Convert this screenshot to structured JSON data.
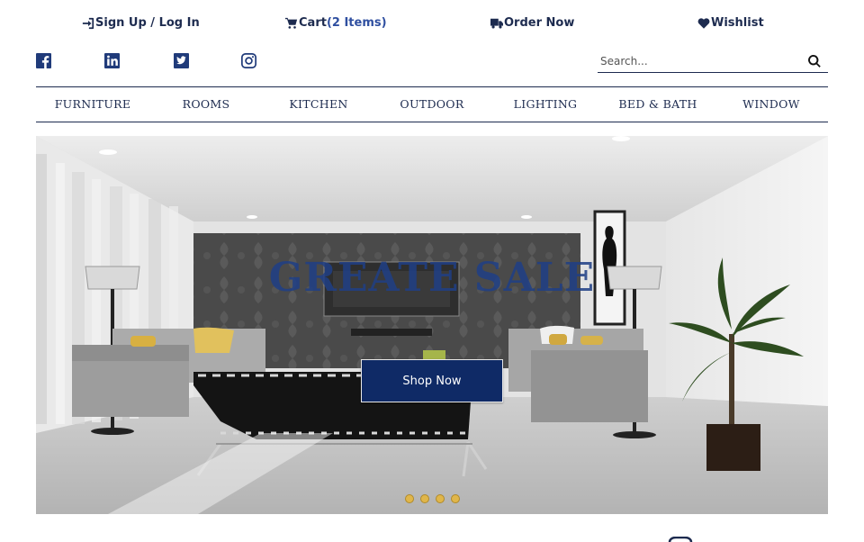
{
  "header": {
    "signup_label": "Sign Up / Log In",
    "cart_label": "Cart",
    "cart_count": "(2 Items)",
    "order_label": "Order Now",
    "wishlist_label": "Wishlist",
    "icons": [
      "sign-in-icon",
      "cart-icon",
      "truck-icon",
      "heart-icon"
    ]
  },
  "social": [
    "facebook-icon",
    "linkedin-icon",
    "twitter-icon",
    "instagram-icon"
  ],
  "search": {
    "placeholder": "Search...",
    "value": ""
  },
  "nav": {
    "items": [
      {
        "label": "FURNITURE"
      },
      {
        "label": "ROOMS"
      },
      {
        "label": "KITCHEN"
      },
      {
        "label": "OUTDOOR"
      },
      {
        "label": "LIGHTING"
      },
      {
        "label": "BED & BATH"
      },
      {
        "label": "WINDOW"
      }
    ]
  },
  "hero": {
    "title": "GREATE SALE",
    "button_label": "Shop Now",
    "slide_count": 4
  },
  "colors": {
    "brand": "#1d2b4f",
    "accent": "#0f2a66",
    "dot": "#e0b64a"
  }
}
